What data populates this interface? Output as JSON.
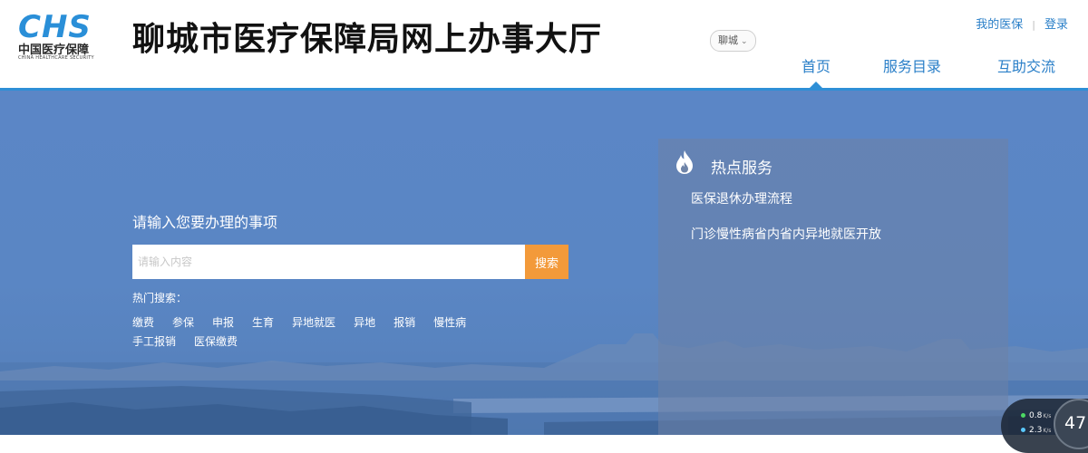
{
  "header": {
    "logo_mark": "CHS",
    "logo_cn": "中国医疗保障",
    "logo_en": "CHINA HEALTHCARE SECURITY",
    "site_title": "聊城市医疗保障局网上办事大厅",
    "city": "聊城",
    "top_links": {
      "my_insurance": "我的医保",
      "login": "登录"
    },
    "nav": [
      {
        "label": "首页",
        "active": true
      },
      {
        "label": "服务目录",
        "active": false
      },
      {
        "label": "互助交流",
        "active": false
      }
    ]
  },
  "search": {
    "label": "请输入您要办理的事项",
    "placeholder": "请输入内容",
    "button": "搜索",
    "hot_label": "热门搜索：",
    "hot_row1": [
      "缴费",
      "参保",
      "申报",
      "生育",
      "异地就医",
      "异地",
      "报销",
      "慢性病"
    ],
    "hot_row2": [
      "手工报销",
      "医保缴费"
    ]
  },
  "hot_services": {
    "title": "热点服务",
    "items": [
      "医保退休办理流程",
      "门诊慢性病省内省内异地就医开放"
    ]
  },
  "speed_widget": {
    "up_value": "0.8",
    "up_unit": "K/s",
    "down_value": "2.3",
    "down_unit": "K/s",
    "percent": "47"
  },
  "colors": {
    "brand_blue": "#2a8fd8",
    "nav_blue": "#2a7fc8",
    "search_button": "#f39a3a",
    "hero_bg": "#5b86c6"
  }
}
